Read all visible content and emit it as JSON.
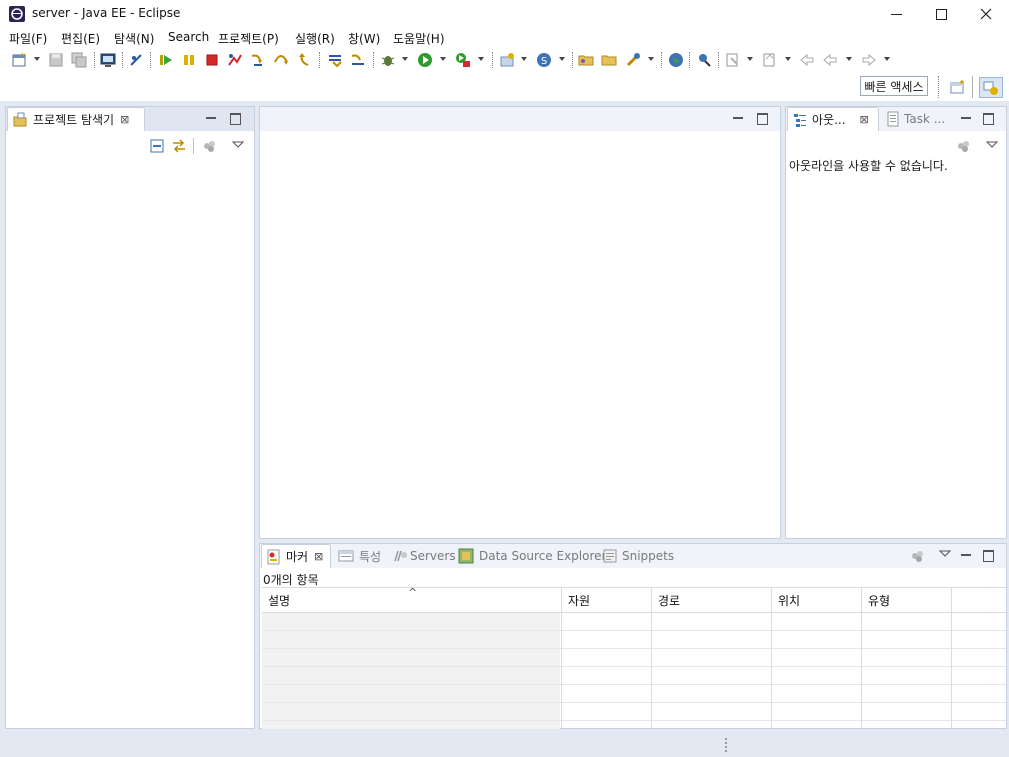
{
  "window": {
    "title": "server - Java EE - Eclipse",
    "controls": {
      "minimize": "—",
      "maximize": "☐",
      "close": "✕"
    }
  },
  "menu": [
    "파일(F)",
    "편집(E)",
    "탐색(N)",
    "Search",
    "프로젝트(P)",
    "실행(R)",
    "창(W)",
    "도움말(H)"
  ],
  "toolbar": {
    "icons": [
      "new-wizard-icon",
      "save-icon",
      "save-all-icon",
      "terminal-icon",
      "skip-breakpoints-icon",
      "resume-icon",
      "suspend-icon",
      "terminate-icon",
      "disconnect-icon",
      "step-into-icon",
      "step-over-icon",
      "step-return-icon",
      "drop-to-frame-icon",
      "use-step-filters-icon",
      "debug-icon",
      "run-icon",
      "run-server-icon",
      "new-server-icon",
      "new-web-service-icon",
      "open-folder-icon",
      "open-project-icon",
      "search-icon",
      "globe-icon",
      "open-perspective-icon",
      "last-edit-icon",
      "back-icon",
      "forward-icon"
    ]
  },
  "quick_access": {
    "label": "빠른 액세스"
  },
  "project_explorer": {
    "tab_label": "프로젝트 탐색기"
  },
  "outline": {
    "tab_label": "아웃...",
    "task_tab_label": "Task ...",
    "message": "아웃라인을 사용할 수 없습니다."
  },
  "bottom_panel": {
    "tabs": [
      {
        "label": "마커",
        "icon": "markers-icon",
        "active": true
      },
      {
        "label": "특성",
        "icon": "properties-icon",
        "active": false
      },
      {
        "label": "Servers",
        "icon": "servers-icon",
        "active": false
      },
      {
        "label": "Data Source Explorer",
        "icon": "data-source-icon",
        "active": false
      },
      {
        "label": "Snippets",
        "icon": "snippets-icon",
        "active": false
      }
    ],
    "item_count": "0개의 항목",
    "columns": [
      "설명",
      "자원",
      "경로",
      "위치",
      "유형"
    ],
    "sort_indicator": "^"
  },
  "colors": {
    "window_bg": "#e3e9f3",
    "panel_border": "#c7d0dd",
    "toolbar_bg": "#ffffff"
  }
}
